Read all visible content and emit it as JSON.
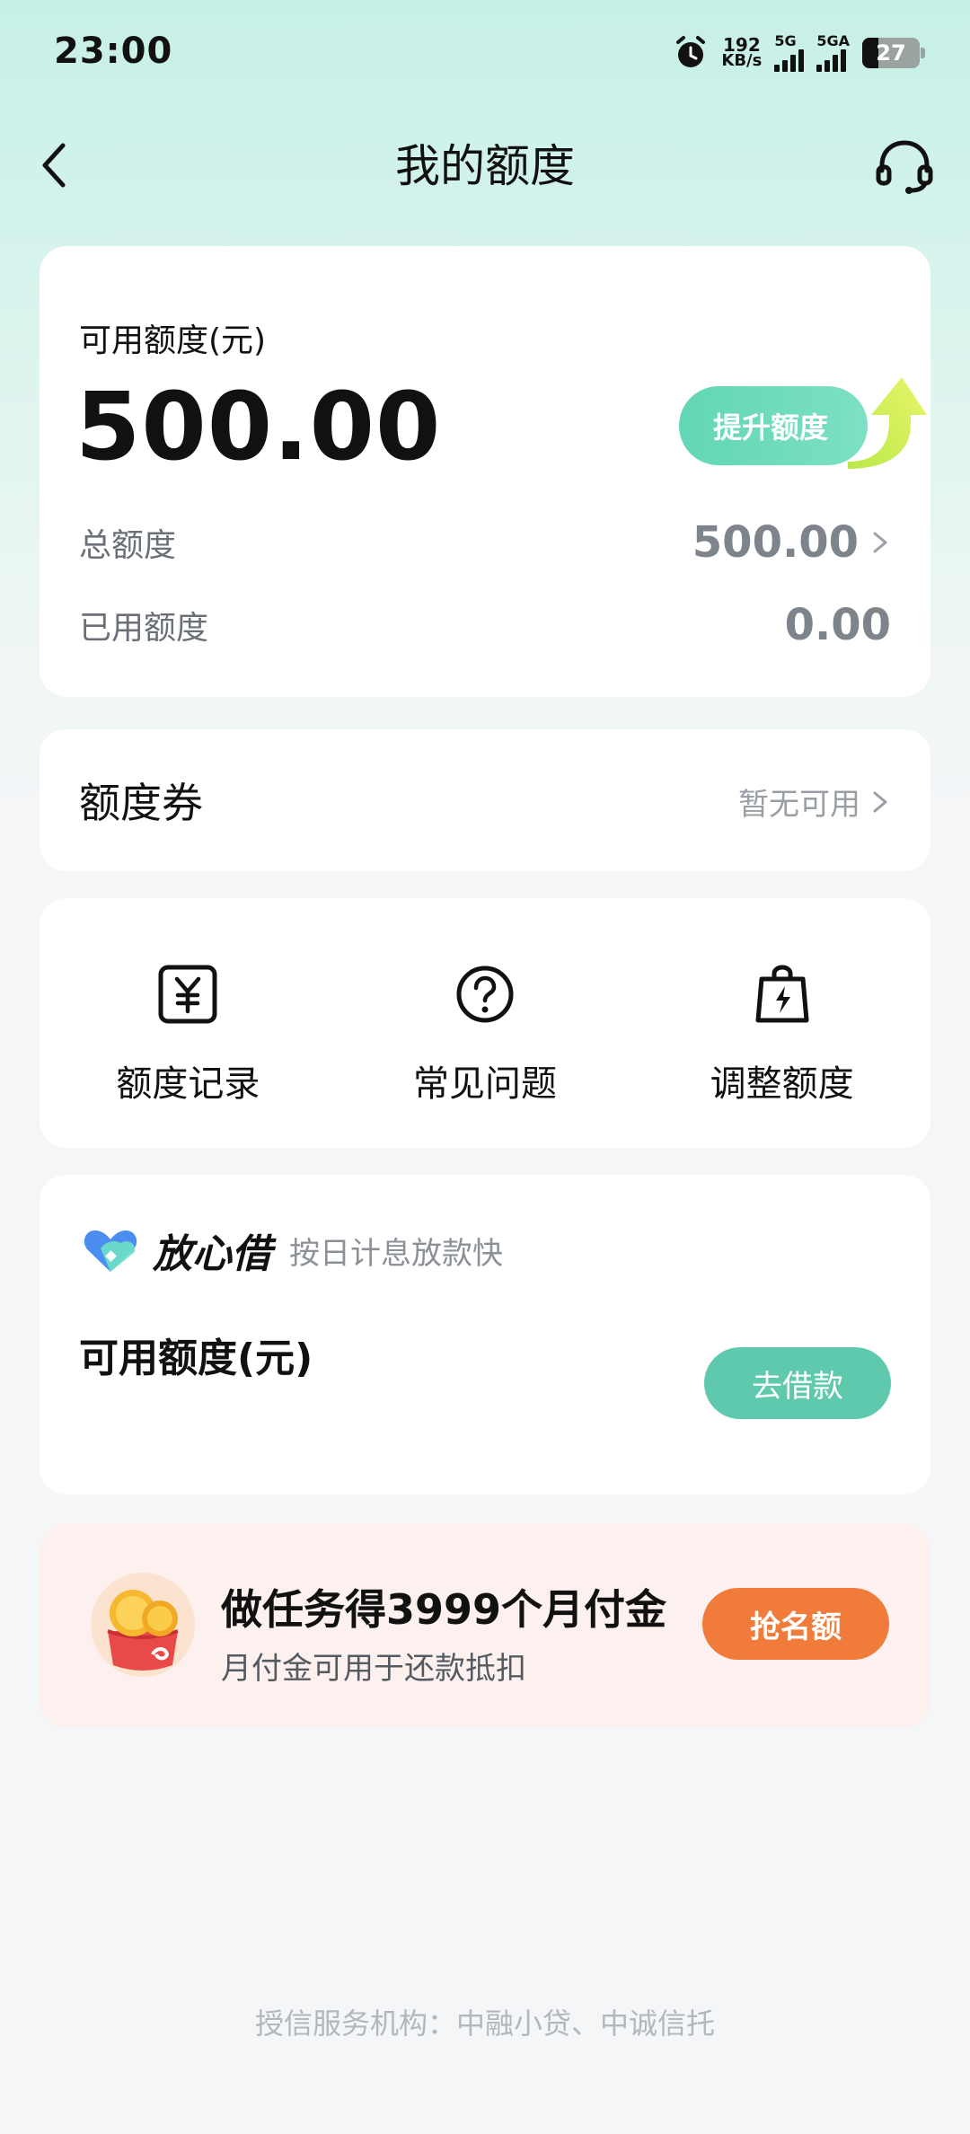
{
  "status_bar": {
    "time": "23:00",
    "net_speed_value": "192",
    "net_speed_unit": "KB/s",
    "signal_1_label": "5G",
    "signal_2_label": "5GA",
    "battery": "27"
  },
  "nav": {
    "title": "我的额度"
  },
  "quota": {
    "label": "可用额度(元)",
    "amount": "500.00",
    "boost_button": "提升额度",
    "total_label": "总额度",
    "total_value": "500.00",
    "used_label": "已用额度",
    "used_value": "0.00"
  },
  "coupon": {
    "title": "额度券",
    "status": "暂无可用"
  },
  "shortcuts": [
    {
      "label": "额度记录",
      "icon": "yuan-record-icon"
    },
    {
      "label": "常见问题",
      "icon": "question-circle-icon"
    },
    {
      "label": "调整额度",
      "icon": "lightning-bag-icon"
    }
  ],
  "loan": {
    "brand_name": "放心借",
    "slogan": "按日计息放款快",
    "label": "可用额度(元)",
    "button": "去借款"
  },
  "task": {
    "title": "做任务得3999个月付金",
    "subtitle": "月付金可用于还款抵扣",
    "button": "抢名额"
  },
  "footer": {
    "text": "授信服务机构：中融小贷、中诚信托"
  },
  "colors": {
    "accent_green": "#5fc9ae",
    "accent_orange": "#f07b3a",
    "header_mint": "#c6f0e6"
  }
}
